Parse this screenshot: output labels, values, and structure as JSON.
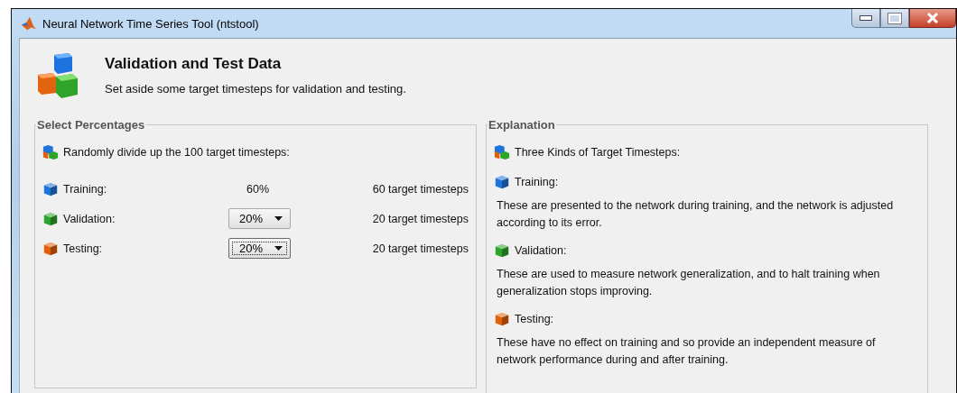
{
  "window": {
    "title": "Neural Network Time Series Tool (ntstool)"
  },
  "header": {
    "title": "Validation and Test Data",
    "subtitle": "Set aside some target timesteps for validation and testing."
  },
  "select_percentages": {
    "legend": "Select Percentages",
    "intro": "Randomly divide up the 100 target timesteps:",
    "rows": [
      {
        "label": "Training:",
        "color": "#1e74d8",
        "kind": "text",
        "value": "60%",
        "count": "60 target timesteps"
      },
      {
        "label": "Validation:",
        "color": "#2ea42a",
        "kind": "dropdown",
        "value": "20%",
        "focused": false,
        "count": "20 target timesteps"
      },
      {
        "label": "Testing:",
        "color": "#e0600c",
        "kind": "dropdown",
        "value": "20%",
        "focused": true,
        "count": "20 target timesteps"
      }
    ]
  },
  "explanation": {
    "legend": "Explanation",
    "intro": "Three Kinds of Target Timesteps:",
    "items": [
      {
        "label": "Training:",
        "color": "#1e74d8",
        "text": "These are presented to the network during training, and the network is adjusted according to its error."
      },
      {
        "label": "Validation:",
        "color": "#2ea42a",
        "text": "These are used to measure network generalization, and to halt training when generalization stops improving."
      },
      {
        "label": "Testing:",
        "color": "#e0600c",
        "text": "These have no effect on training and so provide an independent measure of network performance during and after training."
      }
    ]
  }
}
